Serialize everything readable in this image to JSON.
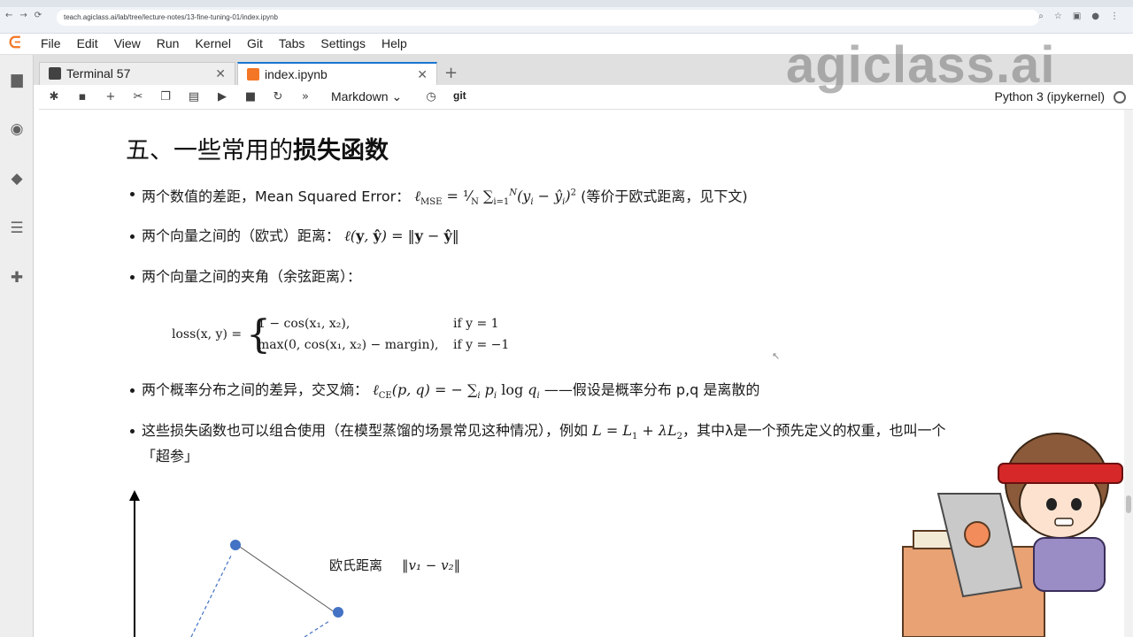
{
  "browser": {
    "url": "teach.agiclass.ai/lab/tree/lecture-notes/13-fine-tuning-01/index.ipynb"
  },
  "menu": [
    "File",
    "Edit",
    "View",
    "Run",
    "Kernel",
    "Git",
    "Tabs",
    "Settings",
    "Help"
  ],
  "tabs": [
    {
      "label": "Terminal 57",
      "icon_color": "#424242"
    },
    {
      "label": "index.ipynb",
      "icon_color": "#f37726"
    }
  ],
  "toolbar": {
    "cell_type": "Markdown",
    "git_label": "git",
    "kernel": "Python 3 (ipykernel)"
  },
  "notebook": {
    "heading_prefix": "五、一些常用的",
    "heading_bold": "损失函数",
    "bullet1_text": "两个数值的差距，Mean Squared Error：",
    "bullet1_suffix": "(等价于欧式距离，见下文)",
    "bullet2_text": "两个向量之间的（欧式）距离：",
    "bullet3_text": "两个向量之间的夹角（余弦距离）：",
    "formula": {
      "lhs": "loss(x, y) =",
      "case1": "1 − cos(x₁, x₂),",
      "case2": "max(0, cos(x₁, x₂) − margin),",
      "cond1": "if y = 1",
      "cond2": "if y = −1"
    },
    "bullet4_text": "两个概率分布之间的差异，交叉熵：",
    "bullet4_suffix": "——假设是概率分布 p,q 是离散的",
    "bullet5_text": "这些损失函数也可以组合使用（在模型蒸馏的场景常见这种情况），例如",
    "bullet5_suffix": "，其中λ是一个预先定义的权重，也叫一个",
    "bullet5_line2": "「超参」",
    "diagram_label": "欧氏距离"
  },
  "watermark": "agiclass.ai",
  "colors": {
    "accent": "#1976d2",
    "jupyter_orange": "#f37726",
    "diagram_blue": "#4472c4"
  }
}
